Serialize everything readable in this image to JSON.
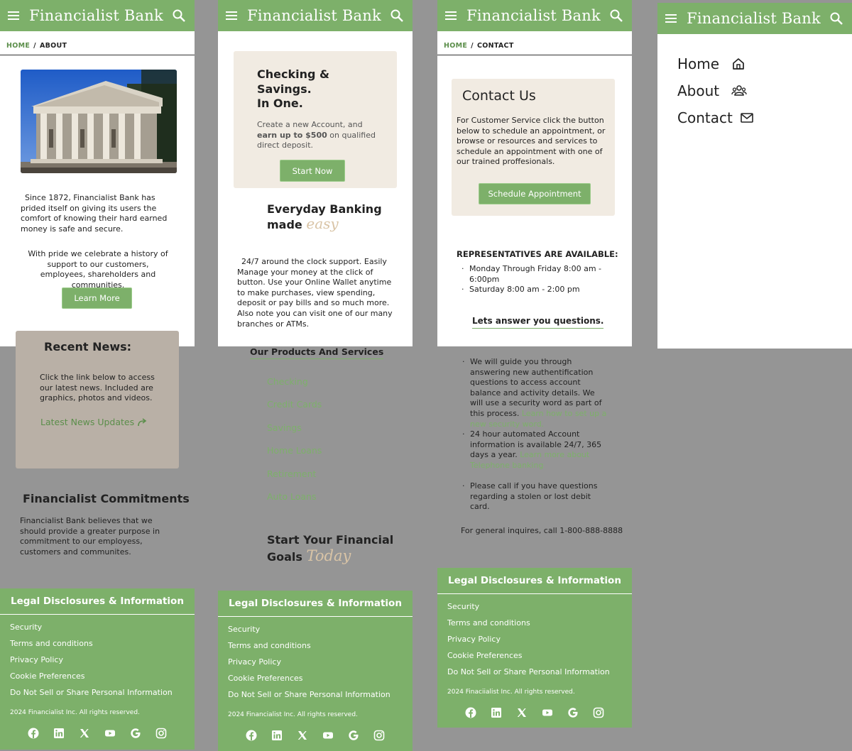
{
  "brand": "Financialist Bank",
  "colors": {
    "primary": "#7db06a",
    "beige": "#f1ebe2",
    "canvas": "#959595"
  },
  "icons": {
    "menu": "hamburger-menu-icon",
    "search": "search-icon"
  },
  "about": {
    "breadcrumb": {
      "home": "HOME",
      "sep": "/",
      "current": "ABOUT"
    },
    "intro": "Since 1872, Financialist Bank has prided itself on giving its users the comfort of knowing their hard earned money is safe and secure.",
    "pride": "With pride we celebrate a history of support to our customers, employees, shareholders and communities.",
    "learn_more": "Learn More",
    "news": {
      "title": "Recent News:",
      "text": "Click the link below to access our latest news. Included are graphics, photos and videos.",
      "link": "Latest News Updates"
    },
    "commit": {
      "title": "Financialist Commitments",
      "text": "Financialist Bank believes that we should provide a greater purpose in commitment to our employess, customers and communites."
    }
  },
  "home": {
    "hero": {
      "title_l1": "Checking &",
      "title_l2": "Savings.",
      "title_l3": "In One.",
      "text_pre": "Create a new Account, and ",
      "text_bold": "earn up to $500",
      "text_post": " on qualified direct deposit.",
      "cta": "Start Now"
    },
    "everyday": {
      "l1": "Everyday Banking",
      "l2": "made",
      "script": "easy"
    },
    "support": "24/7 around the clock support. Easily Manage your money at the click of button. Use your Online Wallet anytime to make purchases, view spending, deposit or pay bills and so much more. Also note you can visit one of our many branches or ATMs.",
    "products_title": "Our Products And Services",
    "products": [
      "Checking",
      "Credit Cards",
      "Savings",
      "Home Loans",
      "Retirement",
      "Auto Loans"
    ],
    "goals": {
      "l1": "Start Your Financial",
      "l2": "Goals",
      "script": "Today"
    }
  },
  "contact": {
    "breadcrumb": {
      "home": "HOME",
      "sep": "/",
      "current": "CONTACT"
    },
    "card": {
      "title": "Contact Us",
      "text": "For Customer Service click the button below to schedule an appointment, or browse or resources and services to schedule an appointment with one of our trained proffesionals.",
      "cta": "Schedule Appointment"
    },
    "reps": {
      "title": "REPRESENTATIVES ARE AVAILABLE:",
      "hours": [
        "Monday Through Friday 8:00 am - 6:00pm",
        "Saturday 8:00 am - 2:00 pm"
      ]
    },
    "answer": "Lets answer you questions.",
    "q1": {
      "text": "We will guide you through answering new authentification questions to access account balance and activity details. We will use a security word as part of this process. ",
      "link": "Learn how to set up a new security word."
    },
    "q2": {
      "text": "24 hour automated Account information is available 24/7, 365 days a year. ",
      "link": "Learn more about Telephone banking"
    },
    "q3": {
      "text": "Please call if you have questions regarding a stolen or lost debit card."
    },
    "general": "For general inquires, call 1-800-888-8888"
  },
  "menu": {
    "items": [
      {
        "label": "Home",
        "icon": "house-icon"
      },
      {
        "label": "About",
        "icon": "people-icon"
      },
      {
        "label": "Contact",
        "icon": "envelope-icon"
      }
    ]
  },
  "footer": {
    "title": "Legal Disclosures & Information",
    "links": [
      "Security",
      "Terms and conditions",
      "Privacy Policy",
      "Cookie Preferences",
      "Do Not Sell or Share Personal Information"
    ],
    "copyright": "2024 Financialist Inc. All rights reserved.",
    "copyright_contact": "2024 Finaciialist Inc. All rights reserved.",
    "social": [
      "facebook-icon",
      "linkedin-icon",
      "x-icon",
      "youtube-icon",
      "google-icon",
      "instagram-icon"
    ]
  }
}
